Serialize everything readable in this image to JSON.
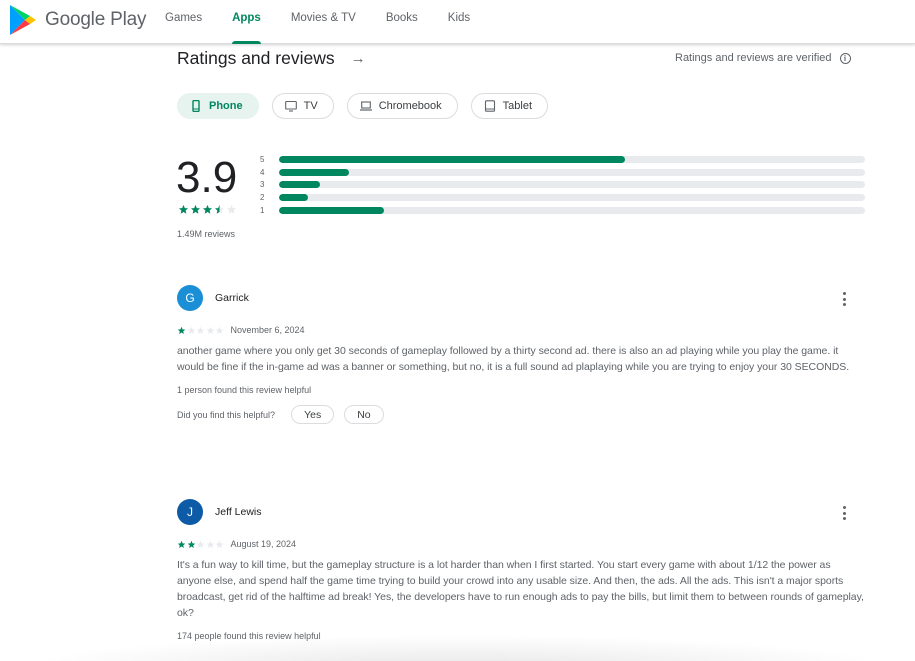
{
  "header": {
    "logo_text": "Google Play",
    "nav": [
      {
        "label": "Games",
        "active": false
      },
      {
        "label": "Apps",
        "active": true
      },
      {
        "label": "Movies & TV",
        "active": false
      },
      {
        "label": "Books",
        "active": false
      },
      {
        "label": "Kids",
        "active": false
      }
    ]
  },
  "section": {
    "title": "Ratings and reviews",
    "arrow": "→",
    "verified_text": "Ratings and reviews are verified",
    "info_glyph": "i"
  },
  "devices": [
    {
      "label": "Phone",
      "icon": "phone-icon",
      "selected": true
    },
    {
      "label": "TV",
      "icon": "tv-icon",
      "selected": false
    },
    {
      "label": "Chromebook",
      "icon": "laptop-icon",
      "selected": false
    },
    {
      "label": "Tablet",
      "icon": "tablet-icon",
      "selected": false
    }
  ],
  "summary": {
    "score": "3.9",
    "stars": 3.5,
    "review_count": "1.49M reviews",
    "distribution": [
      {
        "label": "5",
        "fraction": 0.59
      },
      {
        "label": "4",
        "fraction": 0.12
      },
      {
        "label": "3",
        "fraction": 0.07
      },
      {
        "label": "2",
        "fraction": 0.05
      },
      {
        "label": "1",
        "fraction": 0.18
      }
    ]
  },
  "colors": {
    "accent": "#01875f",
    "track": "#e8eaed",
    "star_empty": "#e8eaed"
  },
  "reviews": [
    {
      "initial": "G",
      "avatar_color": "#1a8fd6",
      "name": "Garrick",
      "stars": 1,
      "date": "November 6, 2024",
      "text": "another game where you only get 30 seconds of gameplay followed by a thirty second ad. there is also an ad playing while you play the game. it would be fine if the in-game ad was a banner or something, but no, it is a full sound ad plaplaying while you are trying to enjoy your 30 SECONDS.",
      "helpful": "1 person found this review helpful",
      "ask": "Did you find this helpful?",
      "yes": "Yes",
      "no": "No"
    },
    {
      "initial": "J",
      "avatar_color": "#0d5aa7",
      "name": "Jeff Lewis",
      "stars": 2,
      "date": "August 19, 2024",
      "text": "It's a fun way to kill time, but the gameplay structure is a lot harder than when I first started. You start every game with about 1/12 the power as anyone else, and spend half the game time trying to build your crowd into any usable size. And then, the ads. All the ads. This isn't a major sports broadcast, get rid of the halftime ad break! Yes, the developers have to run enough ads to pay the bills, but limit them to between rounds of gameplay, ok?",
      "helpful": "174 people found this review helpful"
    }
  ]
}
